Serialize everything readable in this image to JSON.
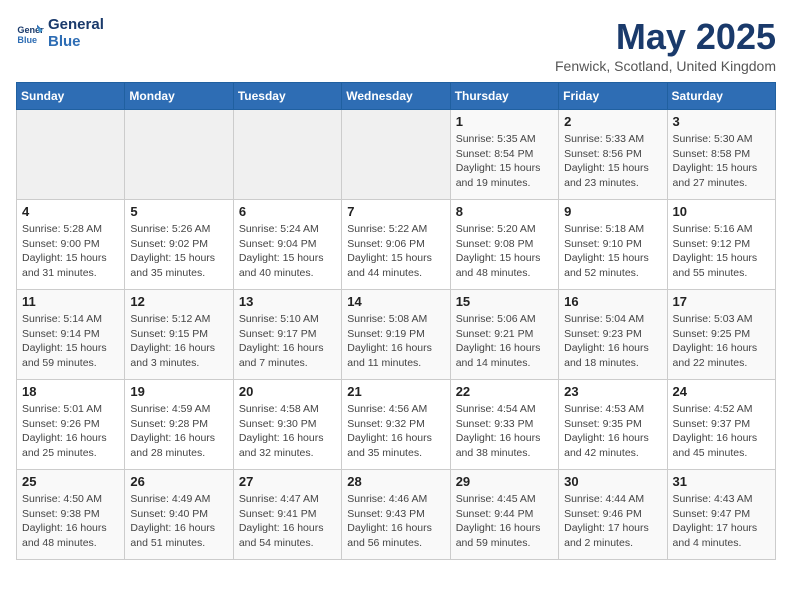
{
  "header": {
    "logo_line1": "General",
    "logo_line2": "Blue",
    "month": "May 2025",
    "location": "Fenwick, Scotland, United Kingdom"
  },
  "weekdays": [
    "Sunday",
    "Monday",
    "Tuesday",
    "Wednesday",
    "Thursday",
    "Friday",
    "Saturday"
  ],
  "weeks": [
    [
      {
        "day": "",
        "info": ""
      },
      {
        "day": "",
        "info": ""
      },
      {
        "day": "",
        "info": ""
      },
      {
        "day": "",
        "info": ""
      },
      {
        "day": "1",
        "info": "Sunrise: 5:35 AM\nSunset: 8:54 PM\nDaylight: 15 hours\nand 19 minutes."
      },
      {
        "day": "2",
        "info": "Sunrise: 5:33 AM\nSunset: 8:56 PM\nDaylight: 15 hours\nand 23 minutes."
      },
      {
        "day": "3",
        "info": "Sunrise: 5:30 AM\nSunset: 8:58 PM\nDaylight: 15 hours\nand 27 minutes."
      }
    ],
    [
      {
        "day": "4",
        "info": "Sunrise: 5:28 AM\nSunset: 9:00 PM\nDaylight: 15 hours\nand 31 minutes."
      },
      {
        "day": "5",
        "info": "Sunrise: 5:26 AM\nSunset: 9:02 PM\nDaylight: 15 hours\nand 35 minutes."
      },
      {
        "day": "6",
        "info": "Sunrise: 5:24 AM\nSunset: 9:04 PM\nDaylight: 15 hours\nand 40 minutes."
      },
      {
        "day": "7",
        "info": "Sunrise: 5:22 AM\nSunset: 9:06 PM\nDaylight: 15 hours\nand 44 minutes."
      },
      {
        "day": "8",
        "info": "Sunrise: 5:20 AM\nSunset: 9:08 PM\nDaylight: 15 hours\nand 48 minutes."
      },
      {
        "day": "9",
        "info": "Sunrise: 5:18 AM\nSunset: 9:10 PM\nDaylight: 15 hours\nand 52 minutes."
      },
      {
        "day": "10",
        "info": "Sunrise: 5:16 AM\nSunset: 9:12 PM\nDaylight: 15 hours\nand 55 minutes."
      }
    ],
    [
      {
        "day": "11",
        "info": "Sunrise: 5:14 AM\nSunset: 9:14 PM\nDaylight: 15 hours\nand 59 minutes."
      },
      {
        "day": "12",
        "info": "Sunrise: 5:12 AM\nSunset: 9:15 PM\nDaylight: 16 hours\nand 3 minutes."
      },
      {
        "day": "13",
        "info": "Sunrise: 5:10 AM\nSunset: 9:17 PM\nDaylight: 16 hours\nand 7 minutes."
      },
      {
        "day": "14",
        "info": "Sunrise: 5:08 AM\nSunset: 9:19 PM\nDaylight: 16 hours\nand 11 minutes."
      },
      {
        "day": "15",
        "info": "Sunrise: 5:06 AM\nSunset: 9:21 PM\nDaylight: 16 hours\nand 14 minutes."
      },
      {
        "day": "16",
        "info": "Sunrise: 5:04 AM\nSunset: 9:23 PM\nDaylight: 16 hours\nand 18 minutes."
      },
      {
        "day": "17",
        "info": "Sunrise: 5:03 AM\nSunset: 9:25 PM\nDaylight: 16 hours\nand 22 minutes."
      }
    ],
    [
      {
        "day": "18",
        "info": "Sunrise: 5:01 AM\nSunset: 9:26 PM\nDaylight: 16 hours\nand 25 minutes."
      },
      {
        "day": "19",
        "info": "Sunrise: 4:59 AM\nSunset: 9:28 PM\nDaylight: 16 hours\nand 28 minutes."
      },
      {
        "day": "20",
        "info": "Sunrise: 4:58 AM\nSunset: 9:30 PM\nDaylight: 16 hours\nand 32 minutes."
      },
      {
        "day": "21",
        "info": "Sunrise: 4:56 AM\nSunset: 9:32 PM\nDaylight: 16 hours\nand 35 minutes."
      },
      {
        "day": "22",
        "info": "Sunrise: 4:54 AM\nSunset: 9:33 PM\nDaylight: 16 hours\nand 38 minutes."
      },
      {
        "day": "23",
        "info": "Sunrise: 4:53 AM\nSunset: 9:35 PM\nDaylight: 16 hours\nand 42 minutes."
      },
      {
        "day": "24",
        "info": "Sunrise: 4:52 AM\nSunset: 9:37 PM\nDaylight: 16 hours\nand 45 minutes."
      }
    ],
    [
      {
        "day": "25",
        "info": "Sunrise: 4:50 AM\nSunset: 9:38 PM\nDaylight: 16 hours\nand 48 minutes."
      },
      {
        "day": "26",
        "info": "Sunrise: 4:49 AM\nSunset: 9:40 PM\nDaylight: 16 hours\nand 51 minutes."
      },
      {
        "day": "27",
        "info": "Sunrise: 4:47 AM\nSunset: 9:41 PM\nDaylight: 16 hours\nand 54 minutes."
      },
      {
        "day": "28",
        "info": "Sunrise: 4:46 AM\nSunset: 9:43 PM\nDaylight: 16 hours\nand 56 minutes."
      },
      {
        "day": "29",
        "info": "Sunrise: 4:45 AM\nSunset: 9:44 PM\nDaylight: 16 hours\nand 59 minutes."
      },
      {
        "day": "30",
        "info": "Sunrise: 4:44 AM\nSunset: 9:46 PM\nDaylight: 17 hours\nand 2 minutes."
      },
      {
        "day": "31",
        "info": "Sunrise: 4:43 AM\nSunset: 9:47 PM\nDaylight: 17 hours\nand 4 minutes."
      }
    ]
  ]
}
